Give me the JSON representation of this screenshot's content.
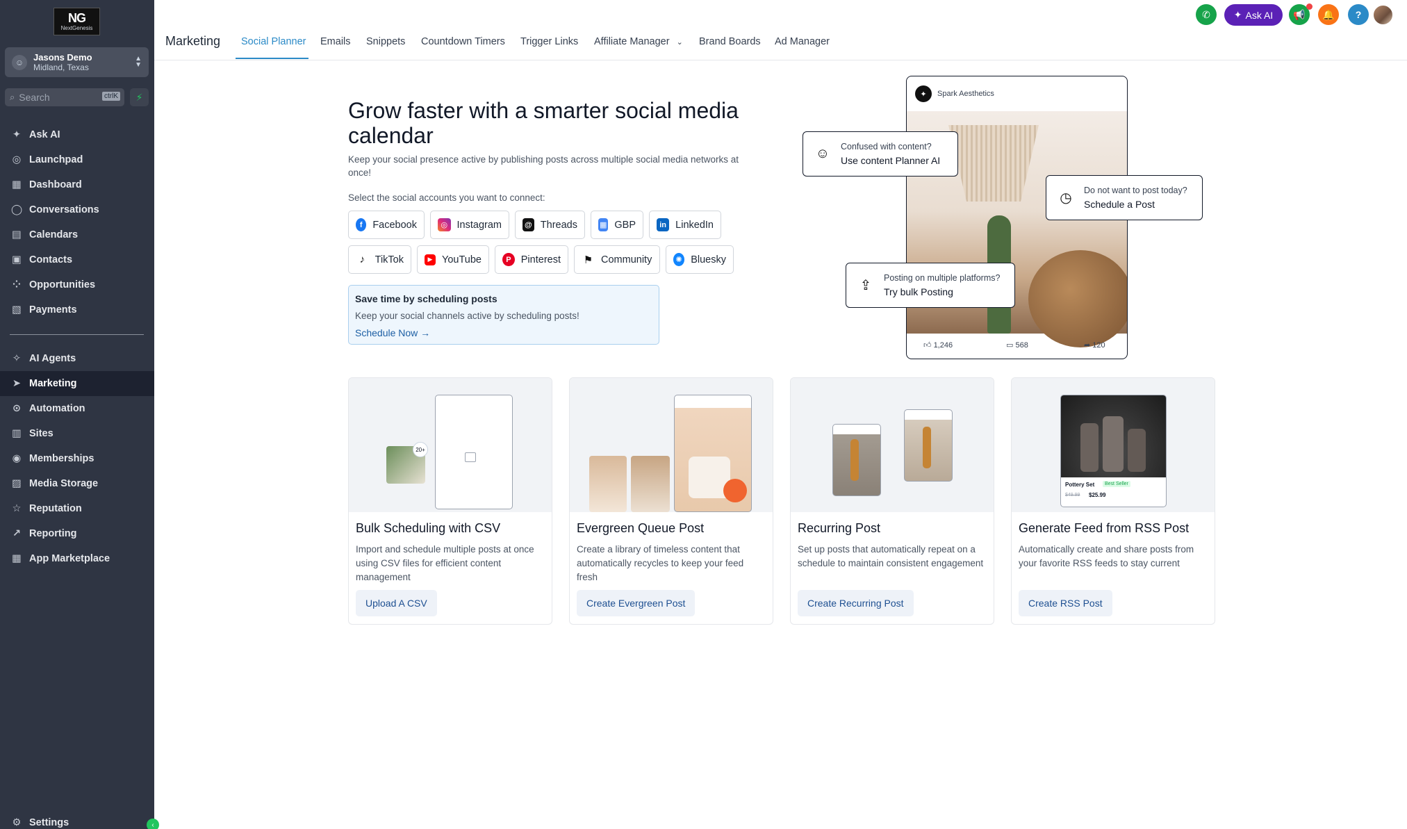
{
  "sidebar": {
    "logo_text": "NextGenesis",
    "account": {
      "name": "Jasons Demo",
      "location": "Midland, Texas"
    },
    "search": {
      "placeholder": "Search",
      "shortcut": "ctrlK"
    },
    "items_top": [
      {
        "label": "Ask AI",
        "icon": "sparkle-icon"
      },
      {
        "label": "Launchpad",
        "icon": "rocket-icon"
      },
      {
        "label": "Dashboard",
        "icon": "grid-icon"
      },
      {
        "label": "Conversations",
        "icon": "chat-icon"
      },
      {
        "label": "Calendars",
        "icon": "calendar-icon"
      },
      {
        "label": "Contacts",
        "icon": "contacts-icon"
      },
      {
        "label": "Opportunities",
        "icon": "pipeline-icon"
      },
      {
        "label": "Payments",
        "icon": "receipt-icon"
      }
    ],
    "items_bottom": [
      {
        "label": "AI Agents",
        "icon": "agent-icon"
      },
      {
        "label": "Marketing",
        "icon": "send-icon"
      },
      {
        "label": "Automation",
        "icon": "automation-icon"
      },
      {
        "label": "Sites",
        "icon": "sites-icon"
      },
      {
        "label": "Memberships",
        "icon": "membership-icon"
      },
      {
        "label": "Media Storage",
        "icon": "image-icon"
      },
      {
        "label": "Reputation",
        "icon": "star-icon"
      },
      {
        "label": "Reporting",
        "icon": "trend-icon"
      },
      {
        "label": "App Marketplace",
        "icon": "apps-icon"
      }
    ],
    "settings_label": "Settings",
    "active": "Marketing"
  },
  "header": {
    "title": "Marketing",
    "tabs": [
      "Social Planner",
      "Emails",
      "Snippets",
      "Countdown Timers",
      "Trigger Links",
      "Affiliate Manager",
      "Brand Boards",
      "Ad Manager"
    ],
    "active_tab": "Social Planner",
    "ask_ai_label": "Ask AI",
    "help_label": "?",
    "colors": {
      "phone": "#16a34a",
      "ask_ai": "#5b21b6",
      "megaphone": "#16a34a",
      "bell": "#f97316",
      "help": "#2b8ac7"
    }
  },
  "hero": {
    "title": "Grow faster with a smarter social media calendar",
    "subtitle": "Keep your social presence active by publishing posts across multiple social media networks at once!",
    "select_label": "Select the social accounts you want to connect:",
    "networks": [
      {
        "label": "Facebook",
        "color": "#1877f2",
        "glyph": "f"
      },
      {
        "label": "Instagram",
        "color": "#d62976",
        "glyph": "◎"
      },
      {
        "label": "Threads",
        "color": "#111111",
        "glyph": "@"
      },
      {
        "label": "GBP",
        "color": "#4285f4",
        "glyph": "▦"
      },
      {
        "label": "LinkedIn",
        "color": "#0a66c2",
        "glyph": "in"
      },
      {
        "label": "TikTok",
        "color": "#111111",
        "glyph": "♪"
      },
      {
        "label": "YouTube",
        "color": "#ff0000",
        "glyph": "▶"
      },
      {
        "label": "Pinterest",
        "color": "#e60023",
        "glyph": "P"
      },
      {
        "label": "Community",
        "color": "#374151",
        "glyph": "⚑"
      },
      {
        "label": "Bluesky",
        "color": "#1185fe",
        "glyph": "🦋"
      }
    ],
    "promo": {
      "title": "Save time by scheduling posts",
      "text": "Keep your social channels active by scheduling posts!",
      "link": "Schedule Now →"
    }
  },
  "mockup": {
    "brand": "Spark Aesthetics",
    "likes": "1,246",
    "comments": "568",
    "shares": "120",
    "callouts": [
      {
        "line1": "Confused with content?",
        "line2": "Use content Planner AI",
        "icon": "robot-icon"
      },
      {
        "line1": "Do not want to post today?",
        "line2": "Schedule a Post",
        "icon": "clock-icon"
      },
      {
        "line1": "Posting on multiple platforms?",
        "line2": "Try bulk Posting",
        "icon": "upload-icon"
      }
    ]
  },
  "cards": [
    {
      "title": "Bulk Scheduling with CSV",
      "desc": "Import and schedule multiple posts at once using CSV files for efficient content management",
      "button": "Upload A CSV",
      "badge": "20+"
    },
    {
      "title": "Evergreen Queue Post",
      "desc": "Create a library of timeless content that automatically recycles to keep your feed fresh",
      "button": "Create Evergreen Post"
    },
    {
      "title": "Recurring Post",
      "desc": "Set up posts that automatically repeat on a schedule to maintain consistent engagement",
      "button": "Create Recurring Post"
    },
    {
      "title": "Generate Feed from RSS Post",
      "desc": "Automatically create and share posts from your favorite RSS feeds to stay current",
      "button": "Create RSS Post",
      "product": {
        "name": "Pottery Set",
        "tag": "Best Seller",
        "old_price": "$49.99",
        "price": "$25.99"
      }
    }
  ]
}
